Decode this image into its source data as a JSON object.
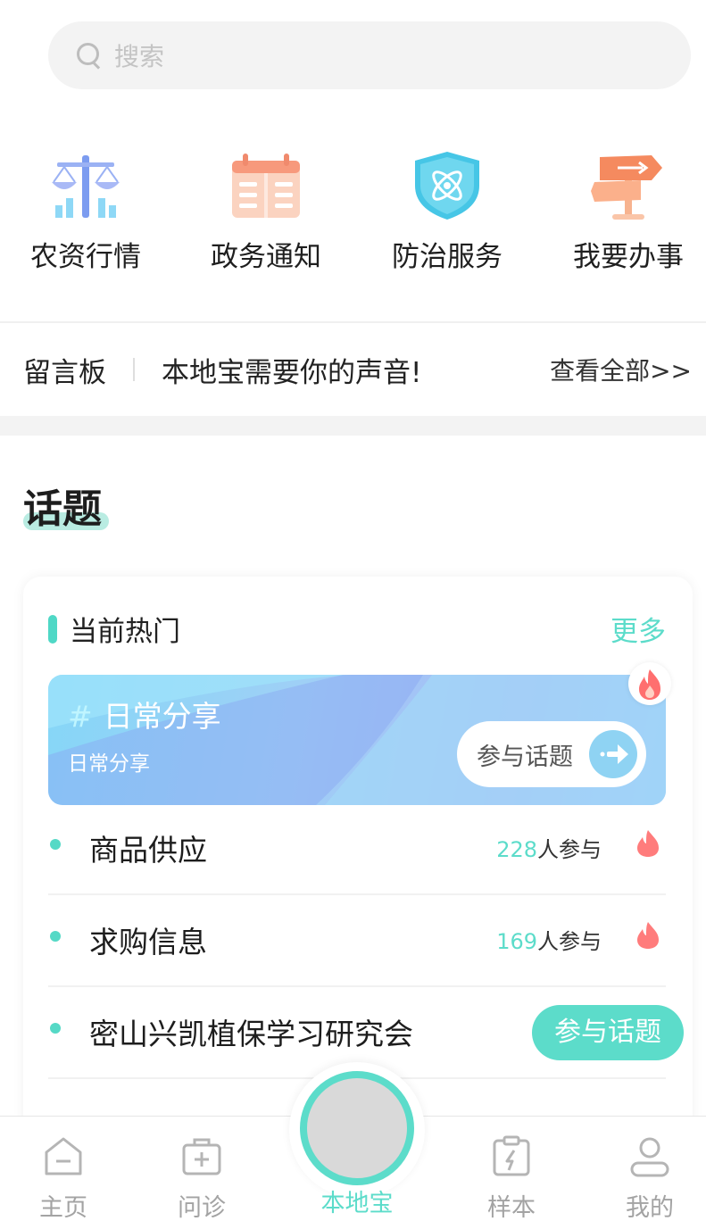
{
  "search": {
    "placeholder": "搜索"
  },
  "quick_actions": [
    {
      "label": "农资行情",
      "icon": "scale-chart-icon"
    },
    {
      "label": "政务通知",
      "icon": "calendar-icon"
    },
    {
      "label": "防治服务",
      "icon": "shield-atom-icon"
    },
    {
      "label": "我要办事",
      "icon": "signpost-icon"
    }
  ],
  "board": {
    "title": "留言板",
    "text": "本地宝需要你的声音!",
    "more": "查看全部>>"
  },
  "topics_section": {
    "title": "话题"
  },
  "hot_card": {
    "title": "当前热门",
    "more": "更多",
    "banner": {
      "hash": "#",
      "title": "日常分享",
      "subtitle": "日常分享",
      "join": "参与话题"
    },
    "rows": [
      {
        "name": "商品供应",
        "count": "228",
        "suffix": "人参与"
      },
      {
        "name": "求购信息",
        "count": "169",
        "suffix": "人参与"
      },
      {
        "name": "密山兴凯植保学习研究会"
      }
    ],
    "float_join": "参与话题"
  },
  "nav": {
    "items": [
      {
        "label": "主页",
        "icon": "home-icon"
      },
      {
        "label": "问诊",
        "icon": "medical-kit-icon"
      },
      {
        "label": "本地宝",
        "icon": "local-center-icon",
        "active": true
      },
      {
        "label": "样本",
        "icon": "sample-clipboard-icon"
      },
      {
        "label": "我的",
        "icon": "user-icon"
      }
    ]
  },
  "colors": {
    "accent": "#5cdcca",
    "fire": "#ff6f6f"
  }
}
